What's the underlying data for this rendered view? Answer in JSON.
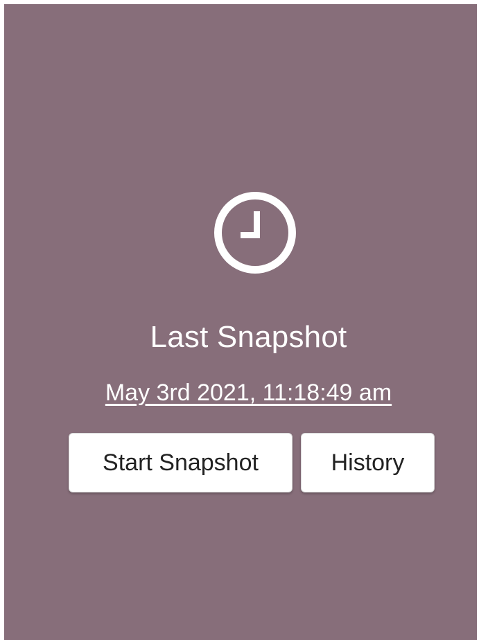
{
  "snapshot": {
    "clock_icon": "clock-icon",
    "title": "Last Snapshot",
    "last_timestamp": "May 3rd 2021, 11:18:49 am",
    "start_button_label": "Start Snapshot",
    "history_button_label": "History"
  },
  "colors": {
    "background": "#876e7a",
    "text": "#ffffff",
    "button_bg": "#ffffff",
    "button_text": "#222222"
  }
}
